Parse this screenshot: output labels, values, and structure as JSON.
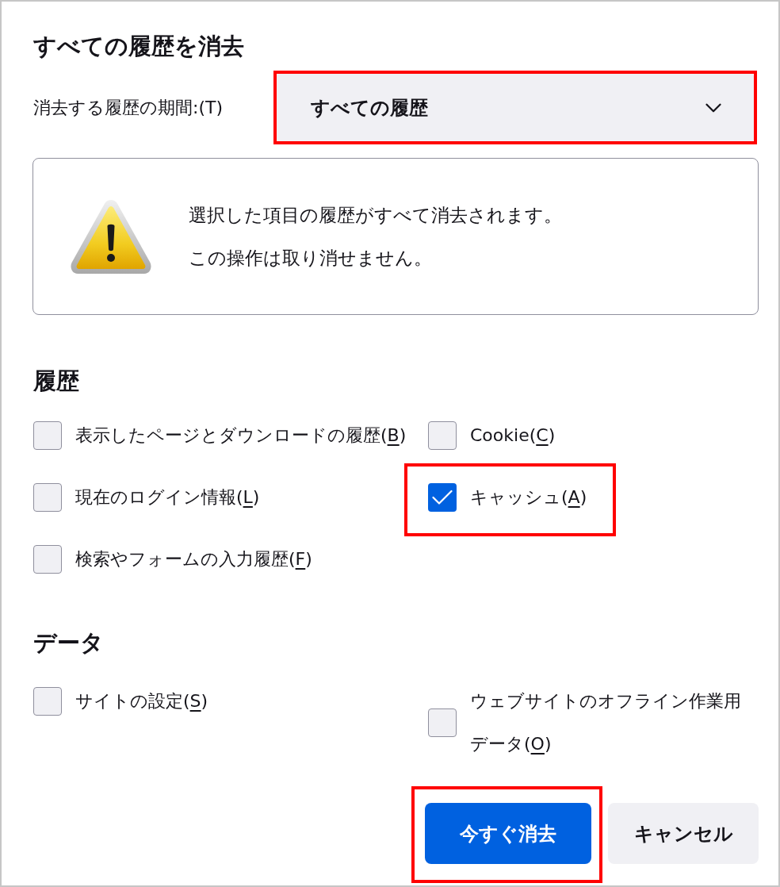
{
  "dialog": {
    "title": "すべての履歴を消去"
  },
  "period": {
    "label": "消去する履歴の期間:(T)",
    "value": "すべての履歴",
    "highlighted": true
  },
  "warning": {
    "lines": [
      "選択した項目の履歴がすべて消去されます。",
      "この操作は取り消せません。"
    ]
  },
  "sections": [
    {
      "heading": "履歴",
      "options": [
        {
          "label": "表示したページとダウンロードの履歴(",
          "access_key": "B",
          "label_end": ")",
          "checked": false,
          "highlighted": false
        },
        {
          "label": "Cookie(",
          "access_key": "C",
          "label_end": ")",
          "checked": false,
          "highlighted": false
        },
        {
          "label": "現在のログイン情報(",
          "access_key": "L",
          "label_end": ")",
          "checked": false,
          "highlighted": false
        },
        {
          "label": "キャッシュ(",
          "access_key": "A",
          "label_end": ")",
          "checked": true,
          "highlighted": true
        },
        {
          "label": "検索やフォームの入力履歴(",
          "access_key": "F",
          "label_end": ")",
          "checked": false,
          "highlighted": false
        }
      ]
    },
    {
      "heading": "データ",
      "options": [
        {
          "label": "サイトの設定(",
          "access_key": "S",
          "label_end": ")",
          "checked": false,
          "highlighted": false
        },
        {
          "label": "ウェブサイトのオフライン作業用データ(",
          "access_key": "O",
          "label_end": ")",
          "checked": false,
          "highlighted": false
        }
      ]
    }
  ],
  "buttons": [
    {
      "label": "今すぐ消去",
      "kind": "primary",
      "highlighted": true
    },
    {
      "label": "キャンセル",
      "kind": "secondary",
      "highlighted": false
    }
  ]
}
